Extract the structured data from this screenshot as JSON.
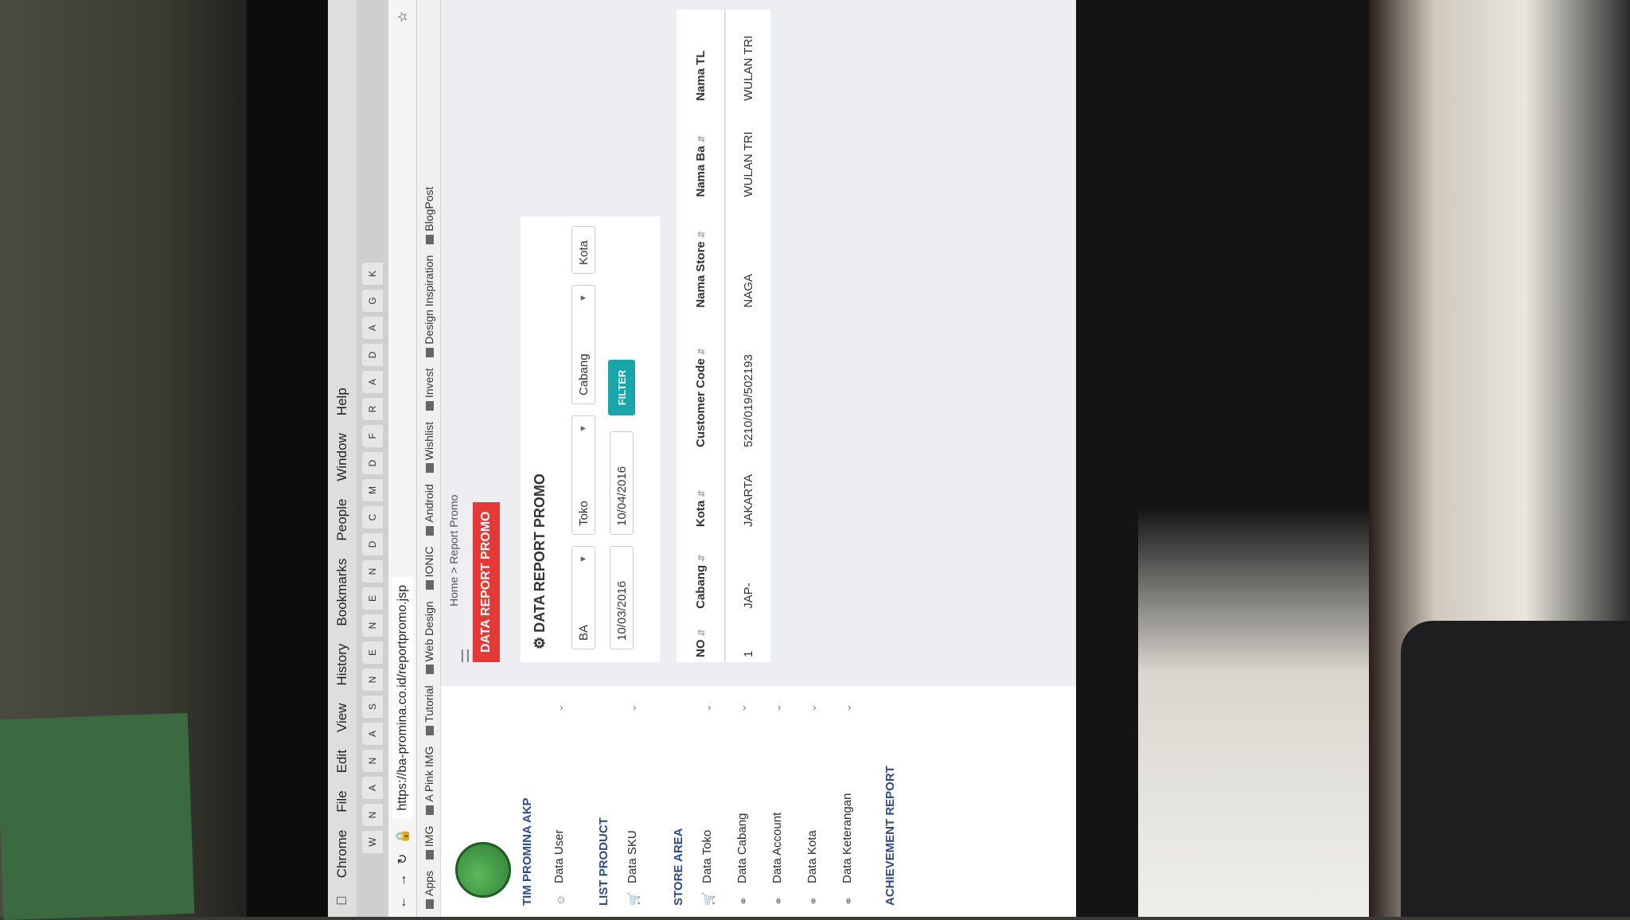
{
  "browser": {
    "menu": [
      "Chrome",
      "File",
      "Edit",
      "View",
      "History",
      "Bookmarks",
      "People",
      "Window",
      "Help"
    ],
    "tabs": [
      "W",
      "N",
      "A",
      "N",
      "A",
      "S",
      "N",
      "E",
      "N",
      "E",
      "N",
      "D",
      "C",
      "M",
      "D",
      "F",
      "R",
      "A",
      "D",
      "A",
      "G",
      "K"
    ],
    "url": "https://ba-promina.co.id/reportpromo.jsp",
    "bookmarks": [
      "Apps",
      "IMG",
      "A Pink IMG",
      "Tutorial",
      "Web Design",
      "IONIC",
      "Android",
      "Wishlist",
      "Invest",
      "Design Inspiration",
      "BlogPost"
    ]
  },
  "sidebar": {
    "header": "TIM PROMINA AKP",
    "items": [
      {
        "label": "Data User",
        "icon": "user-icon"
      },
      {
        "label": "LIST PRODUCT",
        "header": true
      },
      {
        "label": "Data SKU",
        "icon": "cart-icon"
      },
      {
        "label": "STORE AREA",
        "header": true
      },
      {
        "label": "Data Toko",
        "icon": "cart-icon"
      },
      {
        "label": "Data Cabang",
        "icon": "link-icon"
      },
      {
        "label": "Data Account",
        "icon": "link-icon"
      },
      {
        "label": "Data Kota",
        "icon": "link-icon"
      },
      {
        "label": "Data Keterangan",
        "icon": "link-icon"
      },
      {
        "label": "ACHIEVEMENT REPORT",
        "header": true
      }
    ]
  },
  "main": {
    "breadcrumb": "Home > Report Promo",
    "page_title": "DATA REPORT PROMO",
    "panel_title": "DATA REPORT PROMO",
    "filters": {
      "select1": "BA",
      "select2": "Toko",
      "select3": "Cabang",
      "select4": "Kota",
      "date_from": "10/03/2016",
      "date_to": "10/04/2016",
      "filter_label": "FILTER"
    },
    "table": {
      "headers": [
        "NO",
        "Cabang",
        "Kota",
        "Customer Code",
        "Nama Store",
        "Nama Ba",
        "Nama TL"
      ],
      "rows": [
        [
          "1",
          "JAP-",
          "JAKARTA",
          "5210/019/502193",
          "NAGA",
          "WULAN TRI",
          "WULAN TRI"
        ]
      ]
    }
  }
}
